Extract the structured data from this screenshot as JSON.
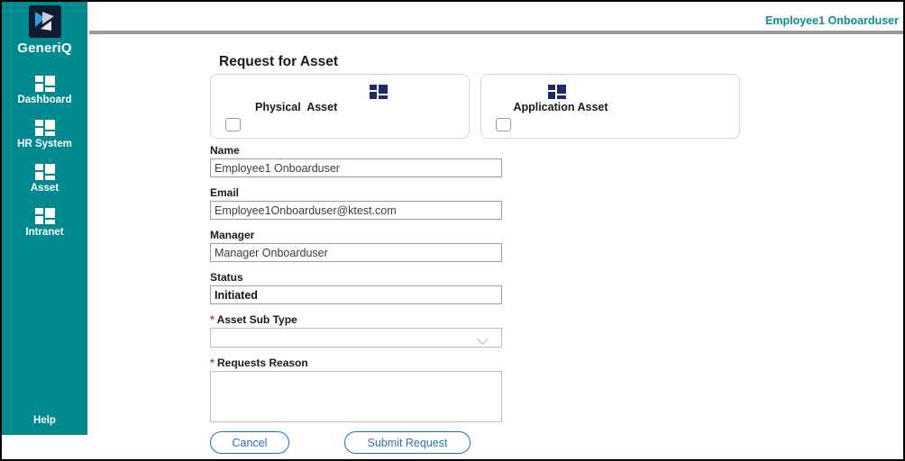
{
  "sidebar": {
    "brand": {
      "name": "GeneriQ",
      "logo_icon": "generiq-logo-icon"
    },
    "items": [
      {
        "label": "Dashboard",
        "icon": "grid-icon"
      },
      {
        "label": "HR System",
        "icon": "grid-icon"
      },
      {
        "label": "Asset",
        "icon": "grid-icon"
      },
      {
        "label": "Intranet",
        "icon": "grid-icon"
      }
    ],
    "help_label": "Help",
    "background_color": "#008a8f"
  },
  "header": {
    "user_name": "Employee1 Onboarduser",
    "user_name_color": "#0a8f96"
  },
  "main": {
    "page_title": "Request for Asset",
    "asset_cards": [
      {
        "label": "Physical  Asset",
        "icon": "grid-icon",
        "checkbox_name": "physical-asset-checkbox",
        "checked": false
      },
      {
        "label": "Application Asset",
        "icon": "grid-icon",
        "checkbox_name": "application-asset-checkbox",
        "checked": false
      }
    ],
    "fields": {
      "name": {
        "label": "Name",
        "value": "Employee1 Onboarduser",
        "placeholder": ""
      },
      "email": {
        "label": "Email",
        "value": "Employee1Onboarduser@ktest.com",
        "placeholder": ""
      },
      "manager": {
        "label": "Manager",
        "value": "Manager Onboarduser",
        "placeholder": ""
      },
      "status": {
        "label": "Status",
        "value": "Initiated",
        "placeholder": ""
      },
      "asset_sub_type": {
        "label": "Asset Sub Type",
        "required_mark": "*",
        "value": "",
        "placeholder": "",
        "chevron_icon": "chevron-down-icon"
      },
      "requests_reason": {
        "label": "Requests Reason",
        "required_mark": "*",
        "value": "",
        "placeholder": ""
      }
    },
    "buttons": {
      "cancel": "Cancel",
      "submit": "Submit Request"
    },
    "accent_color": "#2e6fb7",
    "required_color": "#c0392b"
  }
}
